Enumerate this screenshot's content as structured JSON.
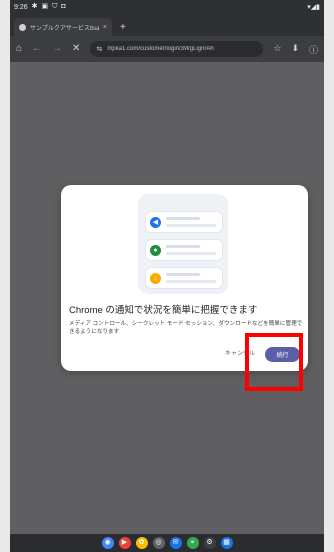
{
  "status_bar": {
    "time": "9:26",
    "icons": [
      "gmail-icon",
      "calendar-icon",
      "shield-icon"
    ],
    "right_icons": "▾◢▮"
  },
  "tab": {
    "title": "サンプルクアサービスbsa",
    "close": "×",
    "new_tab": "+"
  },
  "toolbar": {
    "home": "⌂",
    "back": "←",
    "forward": "→",
    "stop": "✕",
    "tune": "⇆",
    "url": "mpka1.com/customer/login/3WgLignrAh",
    "star": "☆",
    "download": "⬇",
    "info": "ⓘ"
  },
  "dialog": {
    "title": "Chrome の通知で状況を簡単に把握できます",
    "body": "メディア コントロール、シークレット モード セッション、ダウンロードなどを簡単に管理できるようになります",
    "cancel_label": "キャンセル",
    "continue_label": "続行",
    "illustration_icons": [
      {
        "name": "volume-icon",
        "glyph": "◀",
        "color": "#1a73e8"
      },
      {
        "name": "incognito-icon",
        "glyph": "●",
        "color": "#1e8e3e"
      },
      {
        "name": "download-icon",
        "glyph": "↓",
        "color": "#f9ab00"
      }
    ]
  },
  "nav_bar": {
    "apps": [
      {
        "name": "chrome-app-icon",
        "color": "#4285f4",
        "glyph": "◉"
      },
      {
        "name": "youtube-app-icon",
        "color": "#ea4335",
        "glyph": "▶"
      },
      {
        "name": "photos-app-icon",
        "color": "#fbbc04",
        "glyph": "✿"
      },
      {
        "name": "camera-app-icon",
        "color": "#5f6368",
        "glyph": "◎"
      },
      {
        "name": "messages-app-icon",
        "color": "#1a73e8",
        "glyph": "✉"
      },
      {
        "name": "maps-app-icon",
        "color": "#34a853",
        "glyph": "⌖"
      },
      {
        "name": "settings-app-icon",
        "color": "#3c4043",
        "glyph": "⚙"
      },
      {
        "name": "apps-grid-icon",
        "color": "#1a73e8",
        "glyph": "▦"
      }
    ]
  }
}
